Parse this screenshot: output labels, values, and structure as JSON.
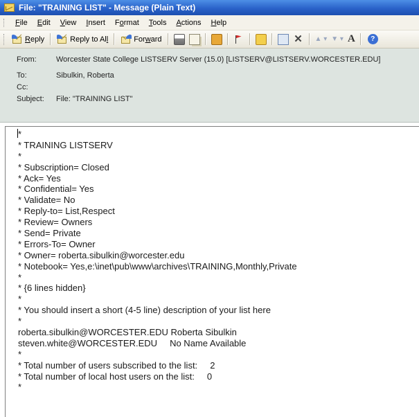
{
  "window": {
    "title": "File: \"TRAINING LIST\" - Message (Plain Text)"
  },
  "menu": [
    {
      "ul": "F",
      "rest": "ile"
    },
    {
      "ul": "E",
      "rest": "dit"
    },
    {
      "ul": "V",
      "rest": "iew"
    },
    {
      "ul": "I",
      "rest": "nsert"
    },
    {
      "pre": "F",
      "ul": "o",
      "rest": "rmat"
    },
    {
      "ul": "T",
      "rest": "ools"
    },
    {
      "ul": "A",
      "rest": "ctions"
    },
    {
      "ul": "H",
      "rest": "elp"
    }
  ],
  "toolbar": {
    "reply": {
      "ul": "R",
      "rest": "eply"
    },
    "reply_all": {
      "pre": "Reply to Al",
      "ul": "l",
      "rest": ""
    },
    "forward": {
      "pre": "For",
      "ul": "w",
      "rest": "ard"
    },
    "font_glyph": "A",
    "help_glyph": "?"
  },
  "header": {
    "from_label": "From:",
    "from_value": "Worcester State College LISTSERV Server (15.0) [LISTSERV@LISTSERV.WORCESTER.EDU]",
    "to_label": "To:",
    "to_value": "Sibulkin, Roberta",
    "cc_label": "Cc:",
    "cc_value": "",
    "subject_label": "Subject:",
    "subject_value": "File: \"TRAINING LIST\""
  },
  "body": {
    "lines": [
      "*",
      "* TRAINING LISTSERV",
      "*",
      "* Subscription= Closed",
      "* Ack= Yes",
      "* Confidential= Yes",
      "* Validate= No",
      "* Reply-to= List,Respect",
      "* Review= Owners",
      "* Send= Private",
      "* Errors-To= Owner",
      "* Owner= roberta.sibulkin@worcester.edu",
      "* Notebook= Yes,e:\\inet\\pub\\www\\archives\\TRAINING,Monthly,Private",
      "*",
      "* {6 lines hidden}",
      "*",
      "* You should insert a short (4-5 line) description of your list here",
      "*",
      "roberta.sibulkin@WORCESTER.EDU Roberta Sibulkin",
      "steven.white@WORCESTER.EDU     No Name Available",
      "*",
      "* Total number of users subscribed to the list:     2",
      "* Total number of local host users on the list:     0",
      "*"
    ]
  }
}
